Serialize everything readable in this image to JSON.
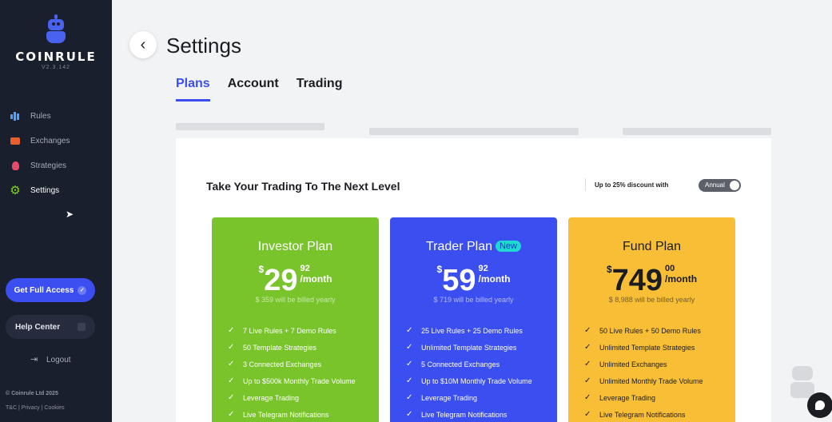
{
  "sidebar": {
    "brand": "COINRULE",
    "version": "V2.3.142",
    "nav": [
      {
        "label": "Rules",
        "icon": "bar-chart-icon"
      },
      {
        "label": "Exchanges",
        "icon": "exchange-icon"
      },
      {
        "label": "Strategies",
        "icon": "lightbulb-icon"
      },
      {
        "label": "Settings",
        "icon": "gear-icon",
        "active": true
      }
    ],
    "full_access_label": "Get Full Access",
    "help_center_label": "Help Center",
    "logout_label": "Logout",
    "copyright": "© Coinrule Ltd 2025",
    "footer_links": [
      "T&C",
      "Privacy",
      "Cookies"
    ]
  },
  "header": {
    "title": "Settings"
  },
  "tabs": [
    {
      "label": "Plans",
      "active": true
    },
    {
      "label": "Account"
    },
    {
      "label": "Trading"
    }
  ],
  "pricing": {
    "title": "Take Your Trading To The Next Level",
    "discount_text": "Up to 25% discount with",
    "toggle_label": "Annual",
    "plans": [
      {
        "name": "Investor Plan",
        "currency": "$",
        "amount": "29",
        "cents": "92",
        "period": "/month",
        "billed": "$ 359 will be billed yearly",
        "color": "#78c42a",
        "features": [
          "7 Live Rules + 7 Demo Rules",
          "50 Template Strategies",
          "3 Connected Exchanges",
          "Up to $500k Monthly Trade Volume",
          "Leverage Trading",
          "Live Telegram Notifications"
        ]
      },
      {
        "name": "Trader Plan",
        "badge": "New",
        "currency": "$",
        "amount": "59",
        "cents": "92",
        "period": "/month",
        "billed": "$ 719 will be billed yearly",
        "color": "#3b4ef0",
        "features": [
          "25 Live Rules + 25 Demo Rules",
          "Unlimited Template Strategies",
          "5 Connected Exchanges",
          "Up to $10M Monthly Trade Volume",
          "Leverage Trading",
          "Live Telegram Notifications"
        ]
      },
      {
        "name": "Fund Plan",
        "currency": "$",
        "amount": "749",
        "cents": "00",
        "period": "/month",
        "billed": "$ 8,988 will be billed yearly",
        "color": "#f7be36",
        "features": [
          "50 Live Rules + 50 Demo Rules",
          "Unlimited Template Strategies",
          "Unlimited Exchanges",
          "Unlimited Monthly Trade Volume",
          "Leverage Trading",
          "Live Telegram Notifications"
        ]
      }
    ]
  }
}
